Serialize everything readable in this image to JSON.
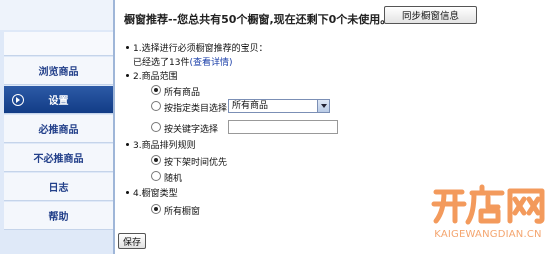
{
  "sidebar": {
    "items": [
      {
        "label": "浏览商品",
        "active": false
      },
      {
        "label": "设置",
        "active": true
      },
      {
        "label": "必推商品",
        "active": false
      },
      {
        "label": "不必推商品",
        "active": false
      },
      {
        "label": "日志",
        "active": false
      },
      {
        "label": "帮助",
        "active": false
      }
    ]
  },
  "header": {
    "title": "橱窗推荐--您总共有50个橱窗,现在还剩下0个未使用。",
    "sync_button": "同步橱窗信息"
  },
  "section1": {
    "label": "1.选择进行必须橱窗推荐的宝贝：",
    "selected_prefix": "已经选了13件",
    "details_link": "(查看详情)"
  },
  "section2": {
    "label": "2.商品范围",
    "options": [
      "所有商品",
      "按指定类目选择",
      "按关键字选择"
    ],
    "selected": 0,
    "category_select": {
      "value": "所有商品"
    },
    "keyword_input": {
      "value": "",
      "placeholder": ""
    }
  },
  "section3": {
    "label": "3.商品排列规则",
    "options": [
      "按下架时间优先",
      "随机"
    ],
    "selected": 0
  },
  "section4": {
    "label": "4.橱窗类型",
    "options": [
      "所有橱窗"
    ],
    "selected": 0
  },
  "save_button": "保存",
  "watermark": {
    "logo_text": "开店网",
    "url_text": "KAIGEWANGDIAN.CN"
  },
  "colors": {
    "sidebar_bg": "#dfe9f8",
    "active_item": "#1a4a98",
    "nav_text": "#23408a",
    "link": "#1a3ea8",
    "watermark": "#f4a56f"
  }
}
